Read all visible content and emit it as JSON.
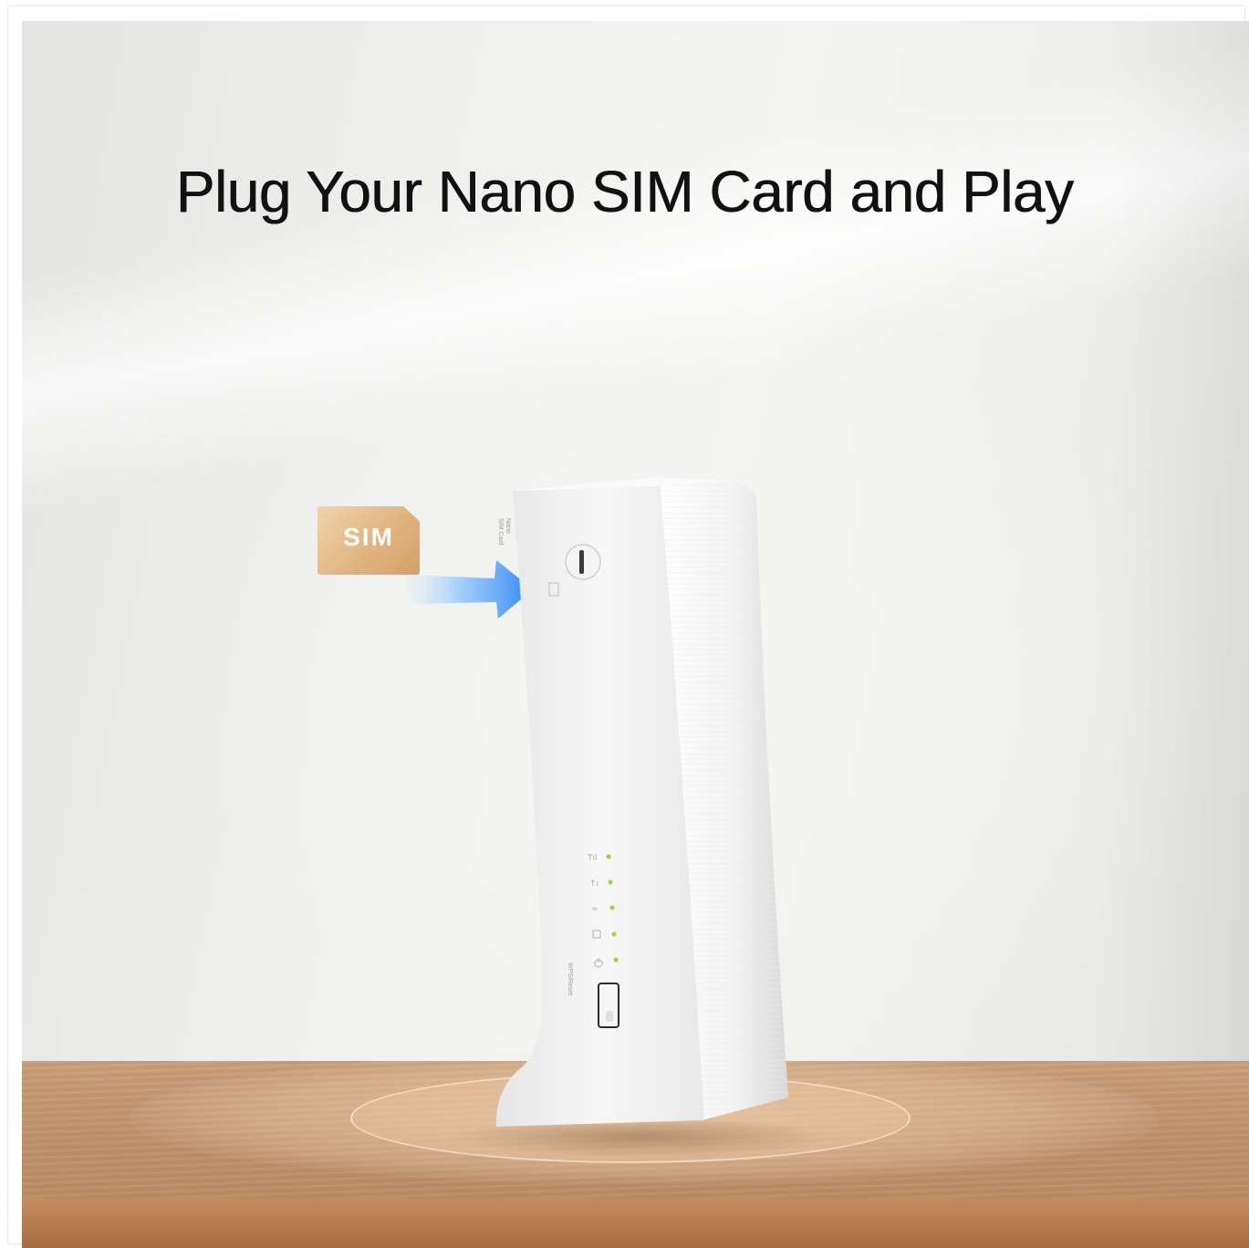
{
  "hero": {
    "title": "Plug Your Nano SIM Card and Play",
    "sim_label": "SIM",
    "slot_label_line1": "Nano",
    "slot_label_line2": "SIM Card",
    "wps_label": "WPS/Reset"
  },
  "colors": {
    "title": "#111111",
    "sim_card": "#dfb27d",
    "arrow": "#3d8ff0",
    "led": "#9bd33c",
    "table": "#bd916b"
  },
  "icons": [
    "sim-card-icon",
    "insert-arrow-icon",
    "signal-led-icon",
    "internet-led-icon",
    "wifi-led-icon",
    "lan-led-icon",
    "power-led-icon"
  ]
}
